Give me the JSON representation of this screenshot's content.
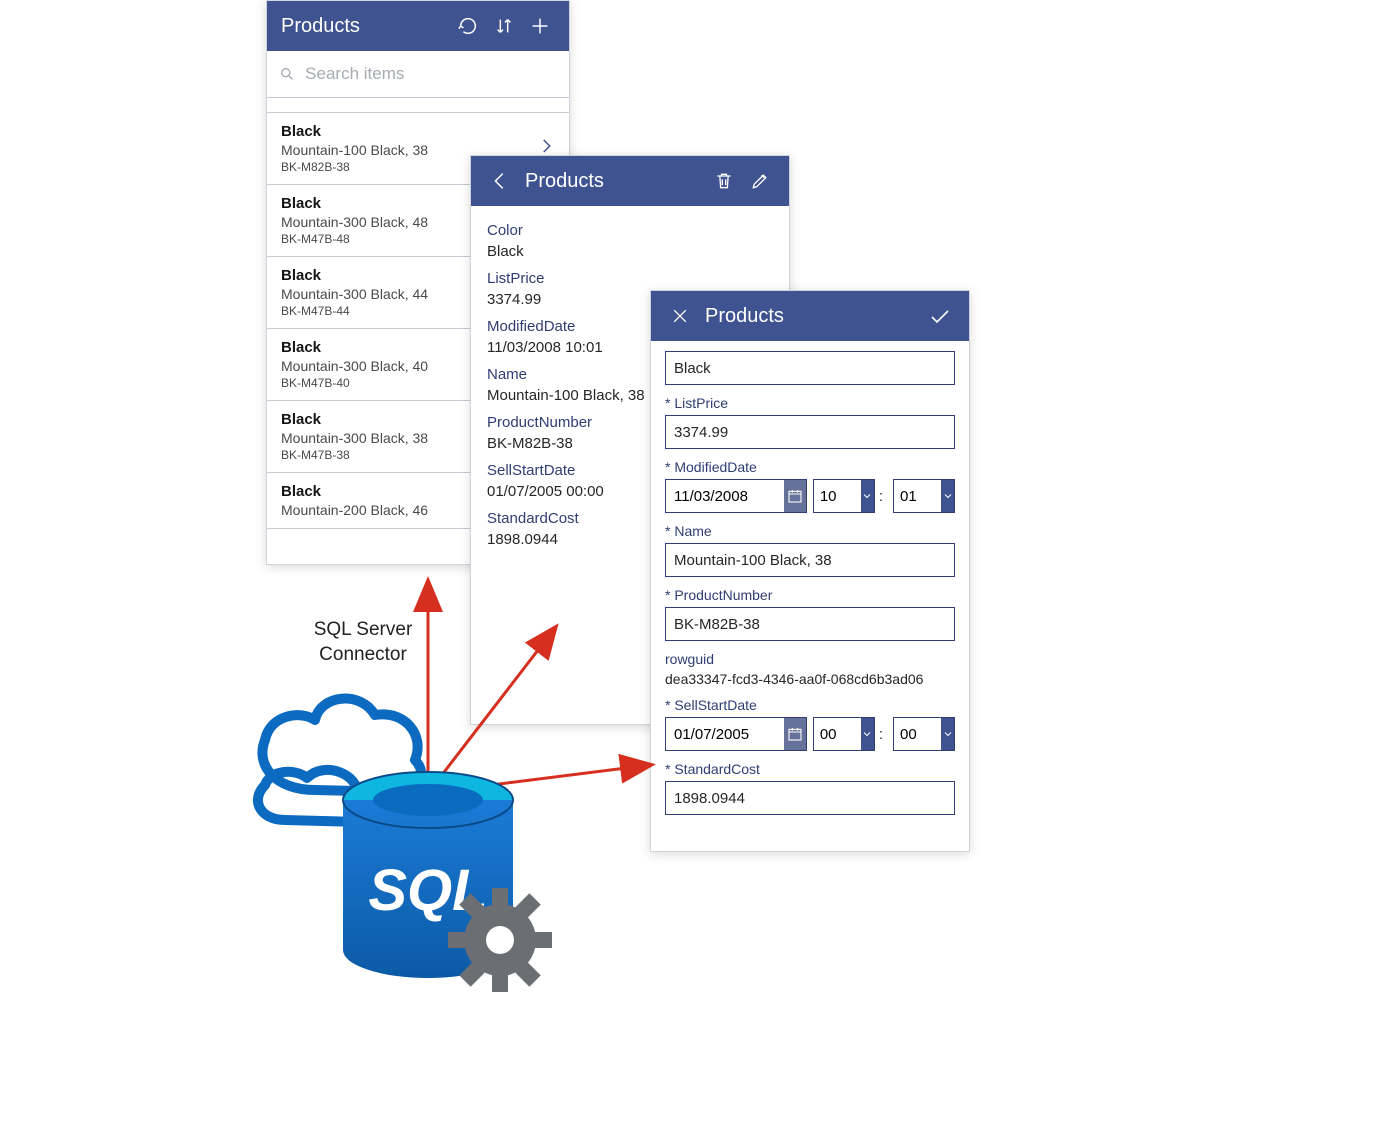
{
  "connector_label_line1": "SQL Server",
  "connector_label_line2": "Connector",
  "sql_logo_text": "SQL",
  "panel_list": {
    "title": "Products",
    "search_placeholder": "Search items",
    "items": [
      {
        "color": "Black",
        "name": "Mountain-100 Black, 38",
        "sku": "BK-M82B-38",
        "has_chevron": true
      },
      {
        "color": "Black",
        "name": "Mountain-300 Black, 48",
        "sku": "BK-M47B-48",
        "has_chevron": false
      },
      {
        "color": "Black",
        "name": "Mountain-300 Black, 44",
        "sku": "BK-M47B-44",
        "has_chevron": false
      },
      {
        "color": "Black",
        "name": "Mountain-300 Black, 40",
        "sku": "BK-M47B-40",
        "has_chevron": false
      },
      {
        "color": "Black",
        "name": "Mountain-300 Black, 38",
        "sku": "BK-M47B-38",
        "has_chevron": false
      },
      {
        "color": "Black",
        "name": "Mountain-200 Black, 46",
        "sku": "",
        "has_chevron": false
      }
    ]
  },
  "panel_detail": {
    "title": "Products",
    "fields": {
      "color_label": "Color",
      "color_value": "Black",
      "listprice_label": "ListPrice",
      "listprice_value": "3374.99",
      "modifieddate_label": "ModifiedDate",
      "modifieddate_value": "11/03/2008 10:01",
      "name_label": "Name",
      "name_value": "Mountain-100 Black, 38",
      "productnumber_label": "ProductNumber",
      "productnumber_value": "BK-M82B-38",
      "sellstartdate_label": "SellStartDate",
      "sellstartdate_value": "01/07/2005 00:00",
      "standardcost_label": "StandardCost",
      "standardcost_value": "1898.0944"
    }
  },
  "panel_edit": {
    "title": "Products",
    "fields": {
      "first_value": "Black",
      "listprice_label": "ListPrice",
      "listprice_value": "3374.99",
      "modifieddate_label": "ModifiedDate",
      "modifieddate_date": "11/03/2008",
      "modifieddate_hour": "10",
      "modifieddate_min": "01",
      "name_label": "Name",
      "name_value": "Mountain-100 Black, 38",
      "productnumber_label": "ProductNumber",
      "productnumber_value": "BK-M82B-38",
      "rowguid_label": "rowguid",
      "rowguid_value": "dea33347-fcd3-4346-aa0f-068cd6b3ad06",
      "sellstartdate_label": "SellStartDate",
      "sellstartdate_date": "01/07/2005",
      "sellstartdate_hour": "00",
      "sellstartdate_min": "00",
      "standardcost_label": "StandardCost",
      "standardcost_value": "1898.0944"
    }
  }
}
